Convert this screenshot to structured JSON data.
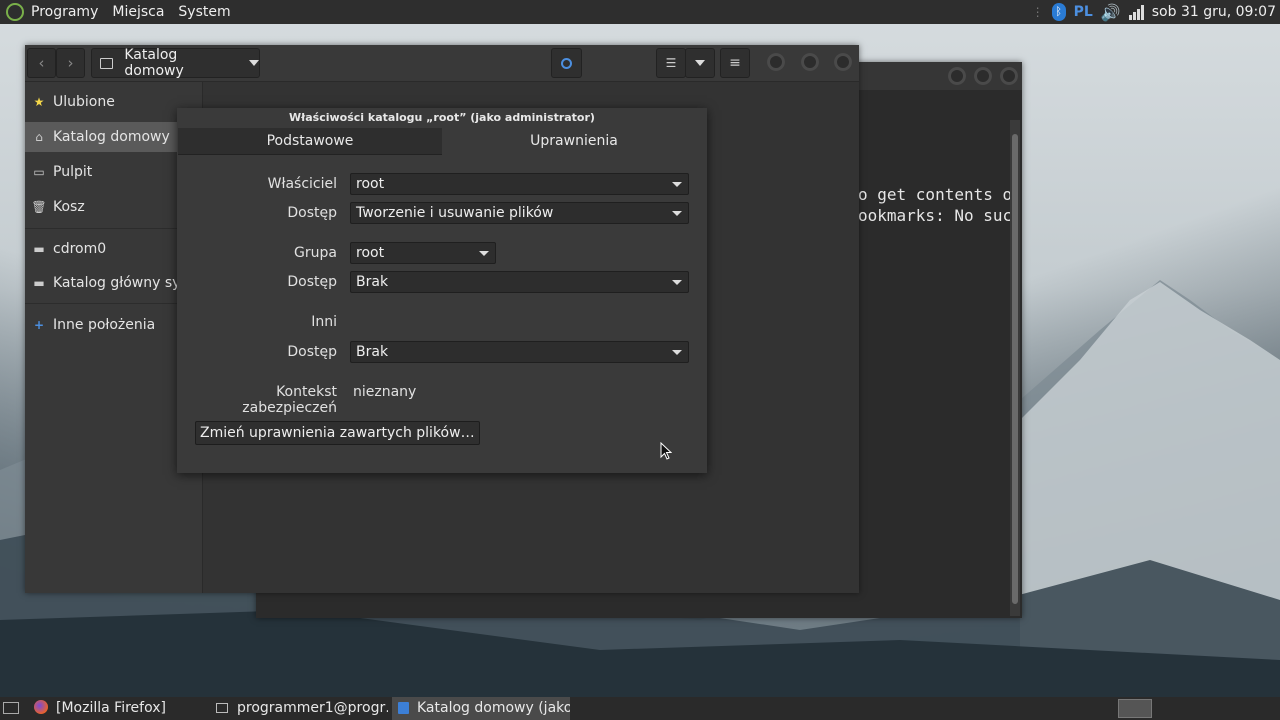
{
  "top_panel": {
    "menus": [
      "Programy",
      "Miejsca",
      "System"
    ],
    "language": "PL",
    "clock": "sob 31 gru, 09:07"
  },
  "file_manager": {
    "location_label": "Katalog domowy",
    "sidebar": {
      "items": [
        {
          "label": "Ulubione",
          "icon": "star-icon"
        },
        {
          "label": "Katalog domowy",
          "icon": "home-folder-icon"
        },
        {
          "label": "Pulpit",
          "icon": "desktop-folder-icon"
        },
        {
          "label": "Kosz",
          "icon": "trash-icon"
        },
        {
          "label": "cdrom0",
          "icon": "drive-icon"
        },
        {
          "label": "Katalog główny sys…",
          "icon": "drive-icon"
        },
        {
          "label": "Inne położenia",
          "icon": "plus-icon"
        }
      ]
    }
  },
  "terminal": {
    "lines": [
      "o get contents o",
      "ookmarks: No suc"
    ]
  },
  "dialog": {
    "title": "Właściwości katalogu „root” (jako administrator)",
    "tabs": [
      "Podstawowe",
      "Uprawnienia"
    ],
    "owner_label": "Właściciel",
    "owner_value": "root",
    "owner_access_label": "Dostęp",
    "owner_access_value": "Tworzenie i usuwanie plików",
    "group_label": "Grupa",
    "group_value": "root",
    "group_access_label": "Dostęp",
    "group_access_value": "Brak",
    "others_label": "Inni",
    "others_access_label": "Dostęp",
    "others_access_value": "Brak",
    "context_label": "Kontekst zabezpieczeń",
    "context_value": "nieznany",
    "change_button": "Zmień uprawnienia zawartych plików…"
  },
  "taskbar": {
    "tasks": [
      "[Mozilla Firefox]",
      "programmer1@progr…",
      "Katalog domowy (jako …"
    ]
  }
}
